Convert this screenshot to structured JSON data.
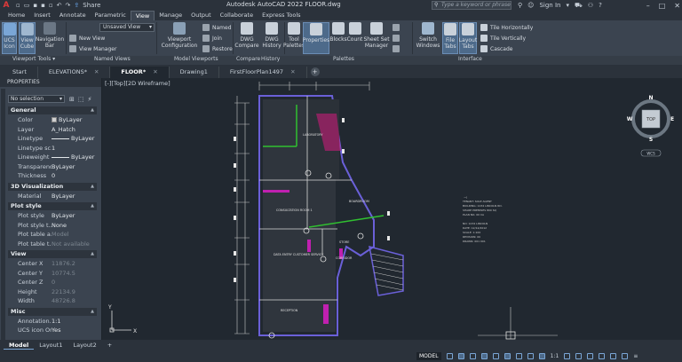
{
  "title": {
    "text": "Autodesk AutoCAD 2022   FLOOR.dwg",
    "logo": "A",
    "qat_share": "Share"
  },
  "search": {
    "placeholder": "Type a keyword or phrase"
  },
  "user": {
    "signin": "Sign In"
  },
  "menu_tabs": [
    "Home",
    "Insert",
    "Annotate",
    "Parametric",
    "View",
    "Manage",
    "Output",
    "Collaborate",
    "Express Tools"
  ],
  "active_menu_tab": "View",
  "ribbon": {
    "ucs_icon": "UCS\nIcon",
    "view_cube": "View\nCube",
    "nav_bar": "Navigation\nBar",
    "unsaved_view": "Unsaved View",
    "new_view": "New View",
    "view_manager": "View Manager",
    "viewport_config": "Viewport\nConfiguration",
    "named": "Named",
    "join": "Join",
    "restore": "Restore",
    "dwg_compare": "DWG\nCompare",
    "dwg_history": "DWG\nHistory",
    "tool_palettes": "Tool\nPalettes",
    "properties": "Properties",
    "blocks": "Blocks",
    "count": "Count",
    "sheet_set": "Sheet Set\nManager",
    "switch_windows": "Switch\nWindows",
    "file_tabs": "File\nTabs",
    "layout_tabs": "Layout\nTabs",
    "tile_h": "Tile Horizontally",
    "tile_v": "Tile Vertically",
    "cascade": "Cascade",
    "panels": [
      "Viewport Tools ▾",
      "Named Views",
      "Model Viewports",
      "Compare",
      "History",
      "Palettes",
      "Interface"
    ]
  },
  "doc_tabs": [
    {
      "label": "Start",
      "active": false,
      "closable": false
    },
    {
      "label": "ELEVATIONS*",
      "active": false,
      "closable": true
    },
    {
      "label": "FLOOR*",
      "active": true,
      "closable": true
    },
    {
      "label": "Drawing1",
      "active": false,
      "closable": false
    },
    {
      "label": "FirstFloorPlan1497",
      "active": false,
      "closable": true
    }
  ],
  "viewport_label": "[-][Top][2D Wireframe]",
  "properties": {
    "header": "PROPERTIES",
    "selection": "No selection",
    "sections": [
      {
        "name": "General",
        "rows": [
          [
            "Color",
            "ByLayer"
          ],
          [
            "Layer",
            "A_Hatch"
          ],
          [
            "Linetype",
            "ByLayer"
          ],
          [
            "Linetype sc...",
            "1"
          ],
          [
            "Lineweight",
            "ByLayer"
          ],
          [
            "Transparency",
            "ByLayer"
          ],
          [
            "Thickness",
            "0"
          ]
        ]
      },
      {
        "name": "3D Visualization",
        "rows": [
          [
            "Material",
            "ByLayer"
          ]
        ]
      },
      {
        "name": "Plot style",
        "rows": [
          [
            "Plot style",
            "ByLayer"
          ],
          [
            "Plot style t...",
            "None"
          ],
          [
            "Plot table a...",
            "Model"
          ],
          [
            "Plot table t...",
            "Not available"
          ]
        ]
      },
      {
        "name": "View",
        "rows": [
          [
            "Center X",
            "11876.2"
          ],
          [
            "Center Y",
            "10774.5"
          ],
          [
            "Center Z",
            "0"
          ],
          [
            "Height",
            "22134.9"
          ],
          [
            "Width",
            "48726.8"
          ]
        ]
      },
      {
        "name": "Misc",
        "rows": [
          [
            "Annotation...",
            "1:1"
          ],
          [
            "UCS icon On",
            "Yes"
          ]
        ]
      }
    ]
  },
  "viewcube": {
    "n": "N",
    "s": "S",
    "e": "E",
    "w": "W",
    "top": "TOP",
    "wcs": "WCS"
  },
  "plan_labels": {
    "lab": "LABORATORY",
    "conf": "CONSULTATION ROOM 1",
    "board": "BOARDROOM",
    "data": "DATA ENTRY CUSTOMER SERVICE",
    "reception": "RECEPTION",
    "store": "STORE",
    "corridor": "CORRIDOR",
    "notes": [
      "TENANT: SOLE AGENT",
      "BUILDING: 1234 LINCOLN RD.",
      "SHARE PREMISES 800 SQ",
      "PLAN NO. 00 CA",
      "NO: 1234 LINCOLN",
      "DATE: 12/12/2012",
      "SCALE: 1:100",
      "REVISION: 00",
      "DRAWN: 001 001"
    ]
  },
  "ucs": {
    "x": "X",
    "y": "Y"
  },
  "layout_tabs": [
    {
      "label": "Model",
      "active": true
    },
    {
      "label": "Layout1",
      "active": false
    },
    {
      "label": "Layout2",
      "active": false
    }
  ],
  "status": {
    "model": "MODEL",
    "scale": "1:1"
  }
}
